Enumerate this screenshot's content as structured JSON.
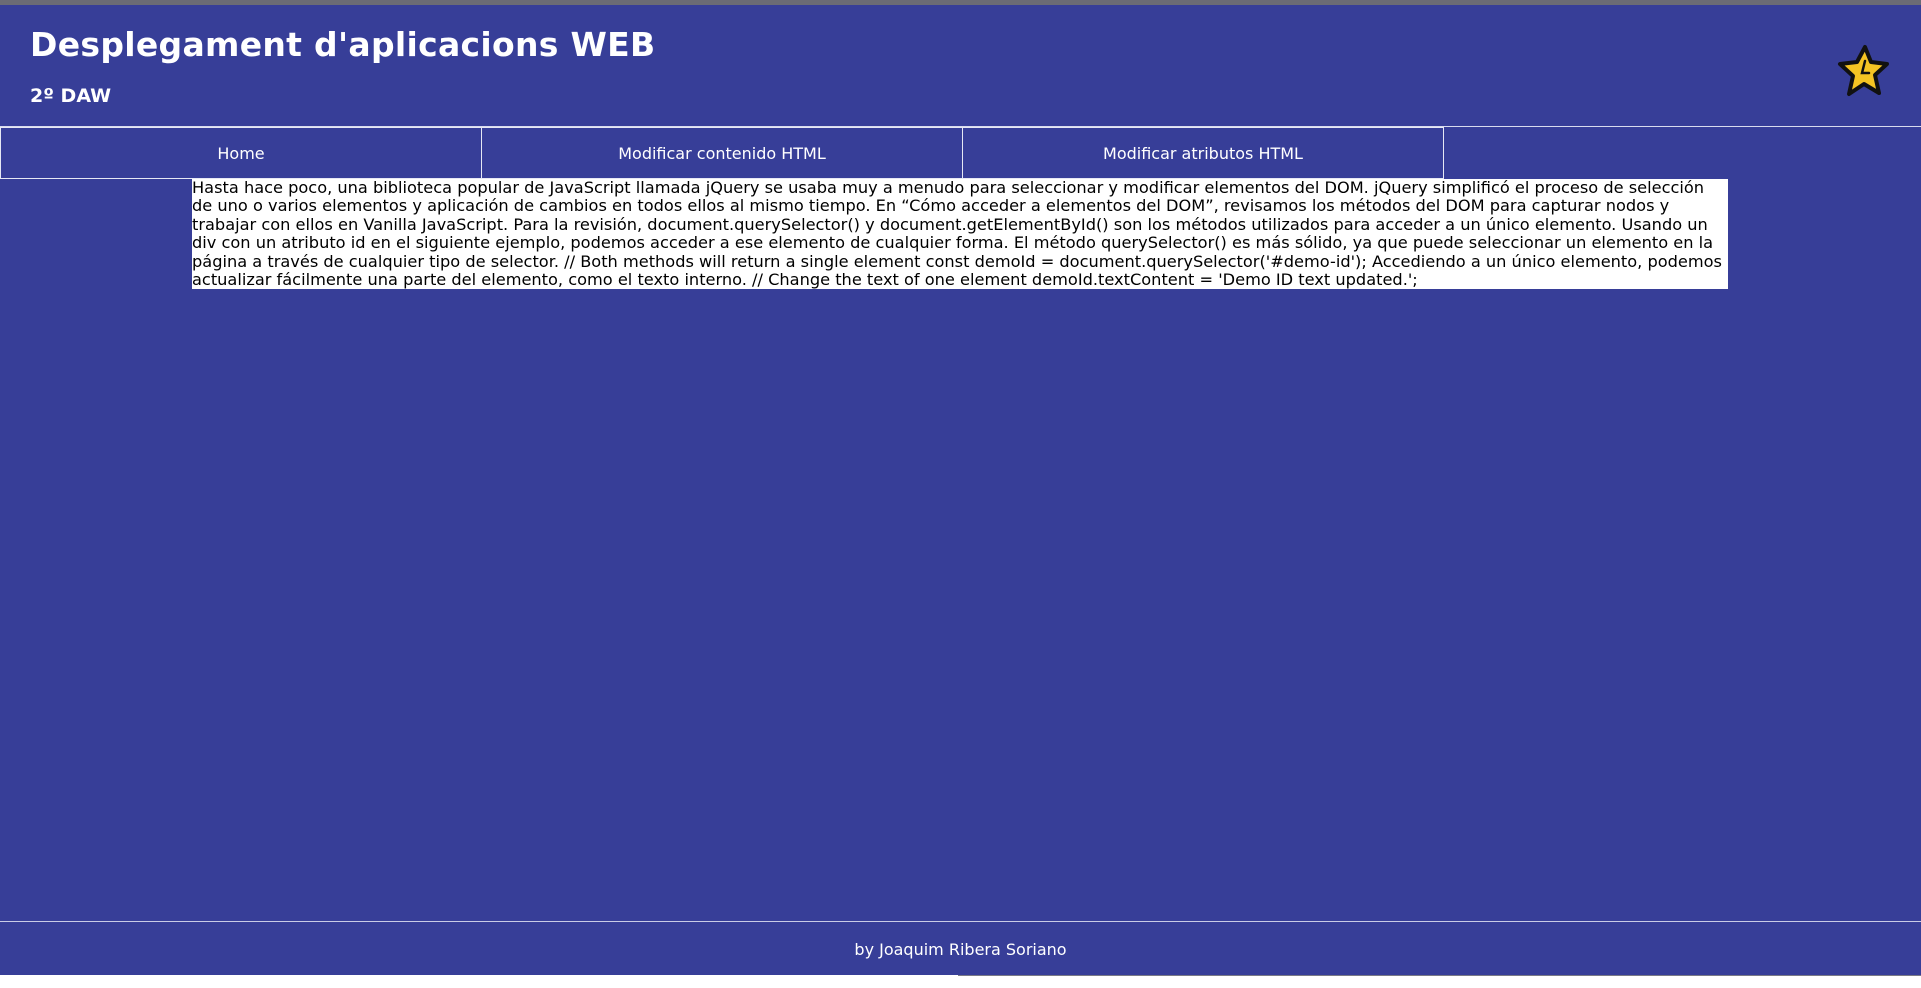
{
  "header": {
    "title": "Desplegament d'aplicacions WEB",
    "subtitle": "2º DAW",
    "logo_icon": "star-logo-icon"
  },
  "nav": {
    "items": [
      {
        "label": "Home"
      },
      {
        "label": "Modificar contenido HTML"
      },
      {
        "label": "Modificar atributos HTML"
      }
    ]
  },
  "main": {
    "text": "Hasta hace poco, una biblioteca popular de JavaScript llamada jQuery se usaba muy a menudo para seleccionar y modificar elementos del DOM. jQuery simplificó el proceso de selección de uno o varios elementos y aplicación de cambios en todos ellos al mismo tiempo. En “Cómo acceder a elementos del DOM”, revisamos los métodos del DOM para capturar nodos y trabajar con ellos en Vanilla JavaScript. Para la revisión, document.querySelector() y document.getElementById() son los métodos utilizados para acceder a un único elemento. Usando un div con un atributo id en el siguiente ejemplo, podemos acceder a ese elemento de cualquier forma. El método querySelector() es más sólido, ya que puede seleccionar un elemento en la página a través de cualquier tipo de selector. // Both methods will return a single element const demoId = document.querySelector('#demo-id'); Accediendo a un único elemento, podemos actualizar fácilmente una parte del elemento, como el texto interno. // Change the text of one element demoId.textContent = 'Demo ID text updated.';"
  },
  "footer": {
    "text": "by Joaquim Ribera Soriano"
  },
  "colors": {
    "background": "#373e98",
    "content_background": "#ffffff",
    "logo_fill": "#f5c423"
  }
}
